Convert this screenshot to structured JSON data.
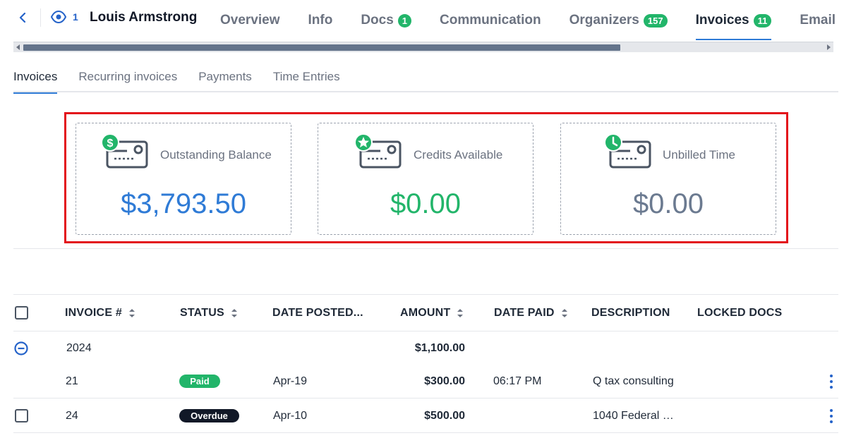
{
  "header": {
    "viewer_count": "1",
    "client_name": "Louis Armstrong",
    "tabs": [
      {
        "label": "Overview",
        "badge": ""
      },
      {
        "label": "Info",
        "badge": ""
      },
      {
        "label": "Docs",
        "badge": "1"
      },
      {
        "label": "Communication",
        "badge": ""
      },
      {
        "label": "Organizers",
        "badge": "157"
      },
      {
        "label": "Invoices",
        "badge": "11"
      },
      {
        "label": "Email",
        "badge": ""
      }
    ],
    "active_tab": "Invoices"
  },
  "subtabs": [
    "Invoices",
    "Recurring invoices",
    "Payments",
    "Time Entries"
  ],
  "cards": [
    {
      "label": "Outstanding Balance",
      "value": "$3,793.50",
      "color": "#2f7bd6",
      "icon": "dollar-badge-icon"
    },
    {
      "label": "Credits Available",
      "value": "$0.00",
      "color": "#22b56a",
      "icon": "star-badge-icon"
    },
    {
      "label": "Unbilled Time",
      "value": "$0.00",
      "color": "#6b7a90",
      "icon": "clock-badge-icon"
    }
  ],
  "table": {
    "columns": [
      "INVOICE #",
      "STATUS",
      "DATE POSTED...",
      "AMOUNT",
      "DATE PAID",
      "DESCRIPTION",
      "LOCKED DOCS"
    ],
    "group": {
      "year": "2024",
      "amount": "$1,100.00"
    },
    "rows": [
      {
        "invoice": "21",
        "status": "Paid",
        "status_color": "#22b56a",
        "date_posted": "Apr-19",
        "amount": "$300.00",
        "date_paid": "06:17 PM",
        "description": "Q tax consulting",
        "locked_docs": ""
      },
      {
        "invoice": "24",
        "status": "Overdue",
        "status_color": "#111827",
        "date_posted": "Apr-10",
        "amount": "$500.00",
        "date_paid": "",
        "description": "1040 Federal …",
        "locked_docs": ""
      }
    ]
  },
  "colors": {
    "accent": "#2f7bd6",
    "success": "#22b56a",
    "highlight": "#e3121b"
  }
}
